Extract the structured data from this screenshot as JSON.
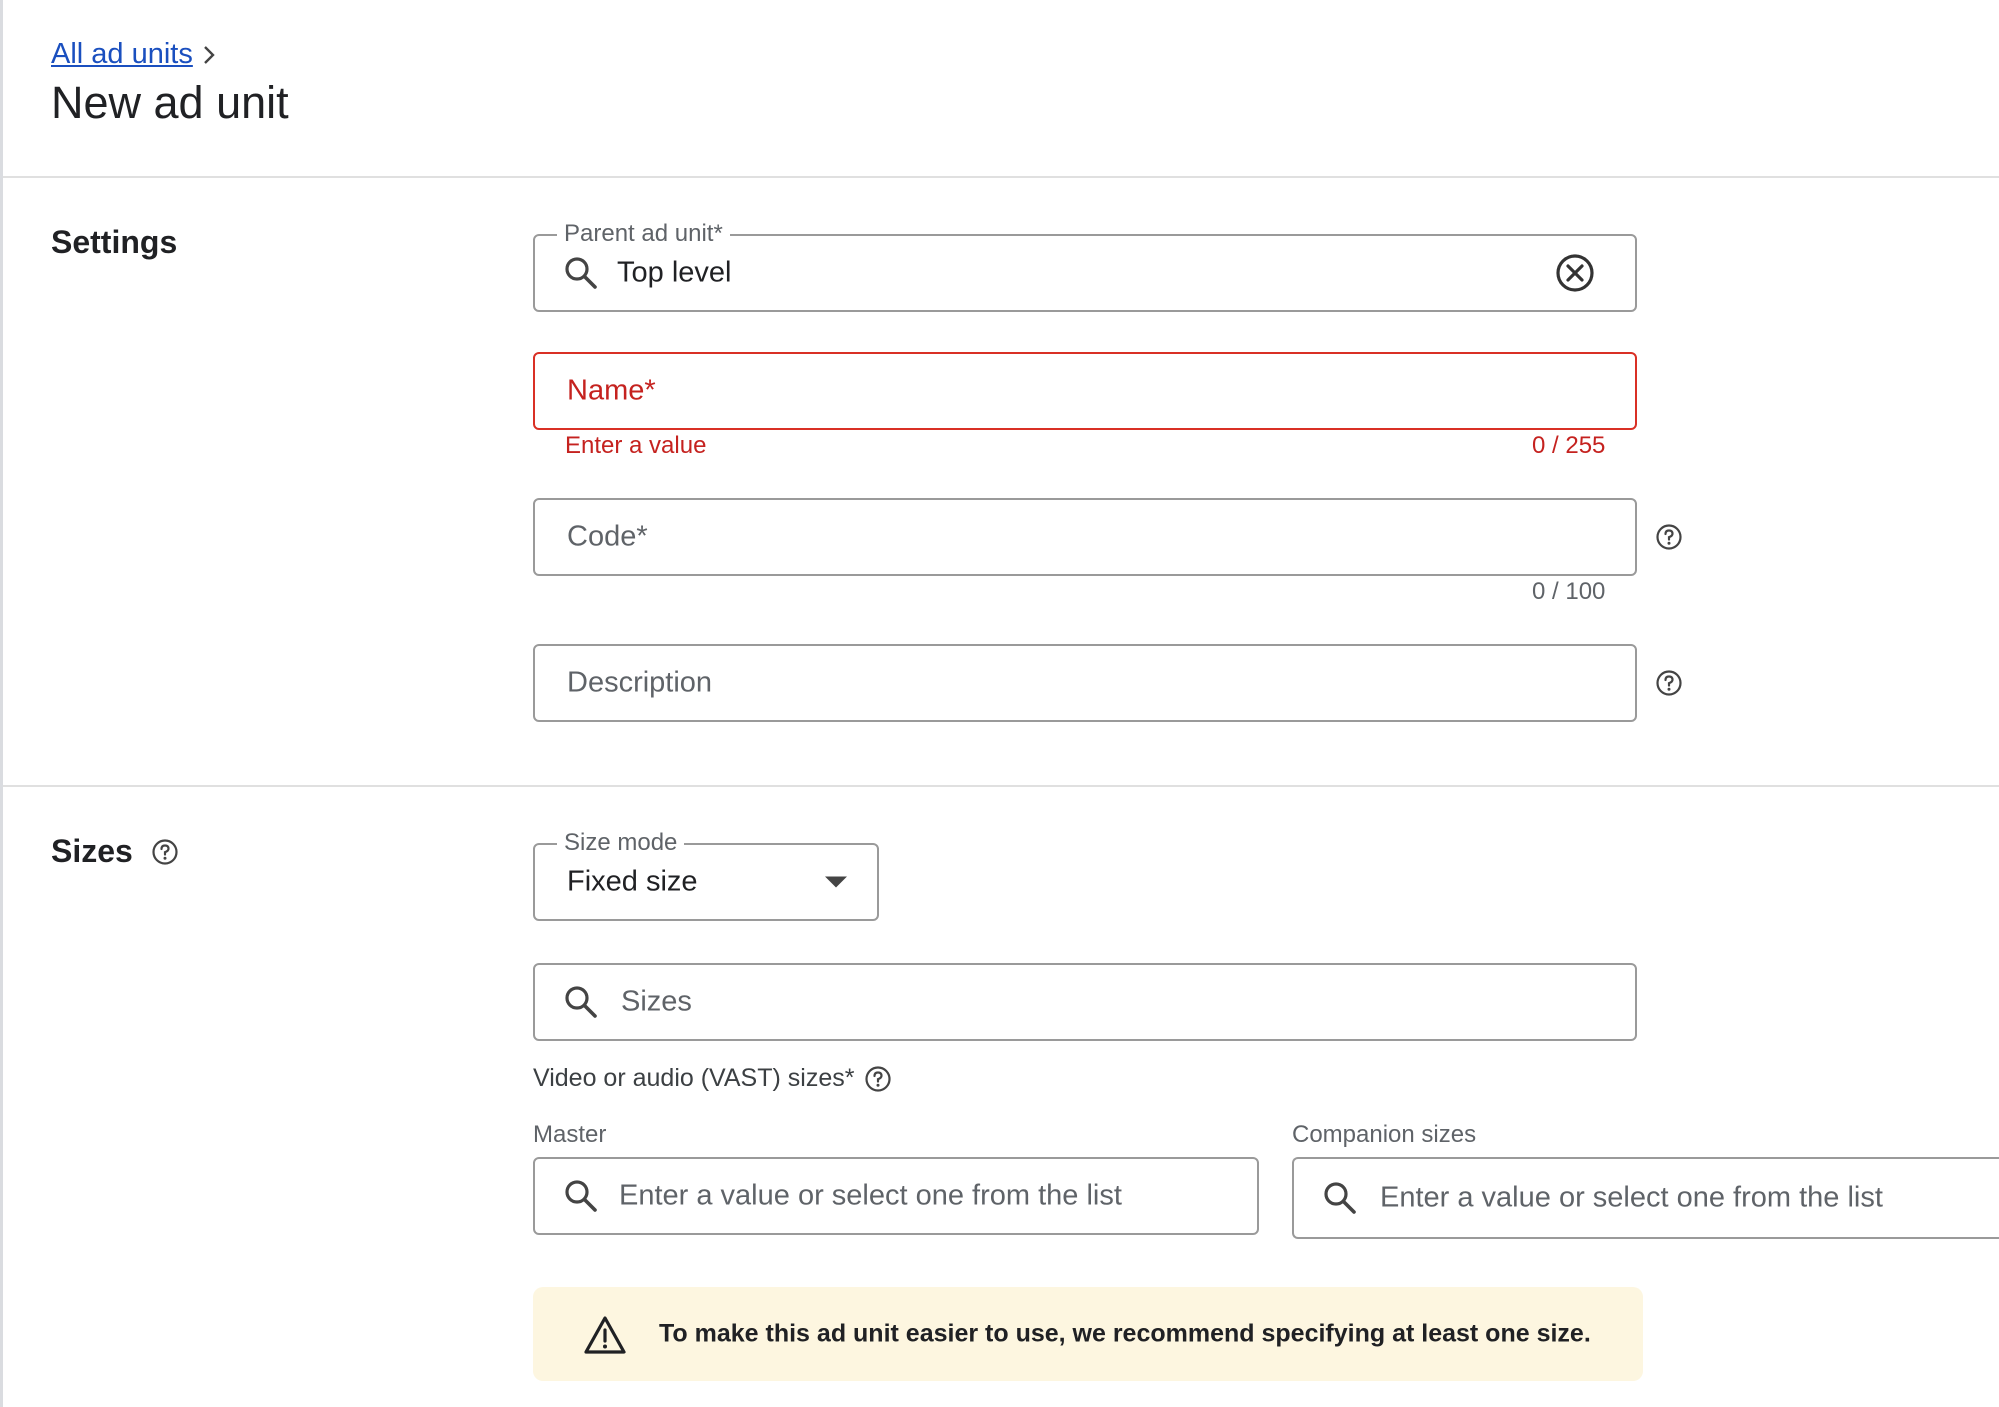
{
  "breadcrumb": {
    "link_label": "All ad units"
  },
  "page_title": "New ad unit",
  "settings": {
    "title": "Settings",
    "parent_ad_unit": {
      "label": "Parent ad unit*",
      "value": "Top level"
    },
    "name": {
      "placeholder": "Name*",
      "error": "Enter a value",
      "counter": "0 / 255"
    },
    "code": {
      "placeholder": "Code*",
      "counter": "0 / 100"
    },
    "description": {
      "placeholder": "Description"
    }
  },
  "sizes": {
    "title": "Sizes",
    "size_mode": {
      "label": "Size mode",
      "value": "Fixed size"
    },
    "sizes_search": {
      "placeholder": "Sizes"
    },
    "vast_label": "Video or audio (VAST) sizes*",
    "master": {
      "label": "Master",
      "placeholder": "Enter a value or select one from the list"
    },
    "companion": {
      "label": "Companion sizes",
      "placeholder": "Enter a value or select one from the list"
    },
    "warning": "To make this ad unit easier to use, we recommend specifying at least one size."
  },
  "icons": {
    "breadcrumb": "chevron-right-icon",
    "search": "search-icon",
    "clear": "clear-circle-icon",
    "help": "help-circle-icon",
    "dropdown": "caret-down-icon",
    "warning": "warning-triangle-icon"
  },
  "colors": {
    "link": "#1a4fbf",
    "error": "#d93025",
    "warning_bg": "#fdf6e0",
    "border": "#9a9a9a"
  }
}
